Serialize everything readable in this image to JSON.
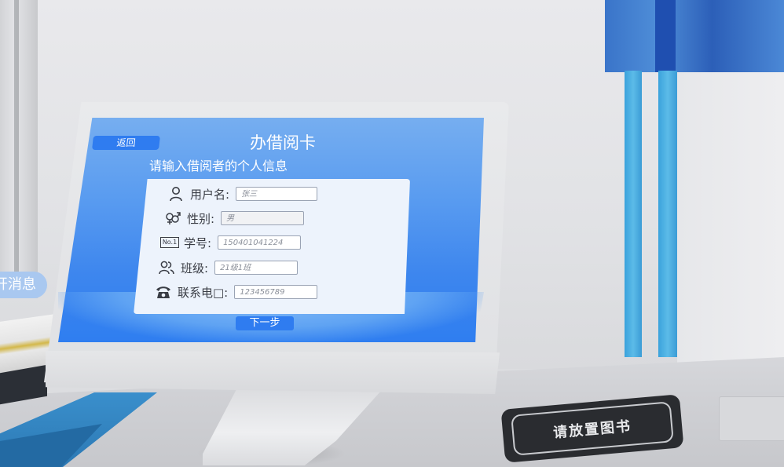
{
  "notification": {
    "text": "开消息"
  },
  "screen": {
    "back_label": "返回",
    "title": "办借阅卡",
    "subtitle": "请输入借阅者的个人信息",
    "next_label": "下一步",
    "fields": [
      {
        "icon": "user-icon",
        "label": "用户名:",
        "value": "张三"
      },
      {
        "icon": "gender-icon",
        "label": "性别:",
        "value": "男"
      },
      {
        "icon": "number-badge-icon",
        "icon_text": "No.1",
        "label": "学号:",
        "value": "150401041224"
      },
      {
        "icon": "group-icon",
        "label": "班级:",
        "value": "21级1班"
      },
      {
        "icon": "phone-icon",
        "label": "联系电□:",
        "value": "123456789"
      }
    ]
  },
  "mat": {
    "text": "请放置图书"
  },
  "colors": {
    "screen_blue": "#3d86ee",
    "button_blue": "#2f7cf0",
    "column_blue": "#4fb3e4",
    "mat_dark": "#2a2c30"
  }
}
